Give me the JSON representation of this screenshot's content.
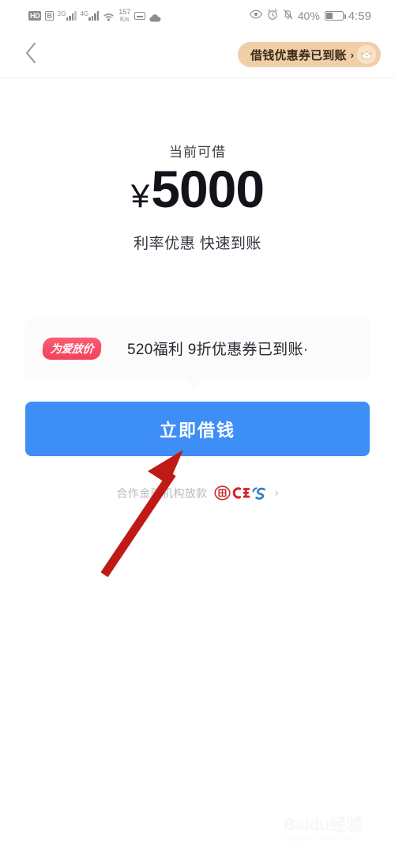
{
  "status_bar": {
    "hd_label": "HD",
    "volte_label": "B",
    "sim1_label": "2G",
    "sim2_label": "4G",
    "network_speed_value": "157",
    "network_speed_unit": "K/s",
    "battery_percent": "40%",
    "time": "4:59",
    "icons": [
      "hd-icon",
      "volte-icon",
      "signal-bars-icon",
      "signal-bars-icon",
      "wifi-icon",
      "network-speed-icon",
      "sim-card-icon",
      "cloud-icon",
      "eye-icon",
      "alarm-clock-icon",
      "bell-muted-icon",
      "battery-icon"
    ]
  },
  "header": {
    "back_icon": "chevron-left-icon",
    "coupon_banner": {
      "label": "借钱优惠券已到账",
      "arrow": "›",
      "icon": "crown-icon",
      "bg_color": "#f0cfa8"
    }
  },
  "main": {
    "available_label": "当前可借",
    "currency_symbol": "¥",
    "amount": "5000",
    "subtitle": "利率优惠 快速到账"
  },
  "promo_card": {
    "badge_label": "为爱放价",
    "badge_color": "#f2425d",
    "text": "520福利 9折优惠券已到账·"
  },
  "cta": {
    "label": "立即借钱",
    "color": "#3d8ef6"
  },
  "footer": {
    "partner_text": "合作金融机构放款",
    "partner_logos": [
      "zhongyuan-bank-logo",
      "cgb-logo",
      "css-logo"
    ],
    "chevron": "›"
  },
  "annotation": {
    "arrow_color": "#c01a16",
    "points_to": "立即借钱"
  },
  "watermark": {
    "main": "Baidu经验",
    "sub": "jingyan.baidu.com"
  }
}
